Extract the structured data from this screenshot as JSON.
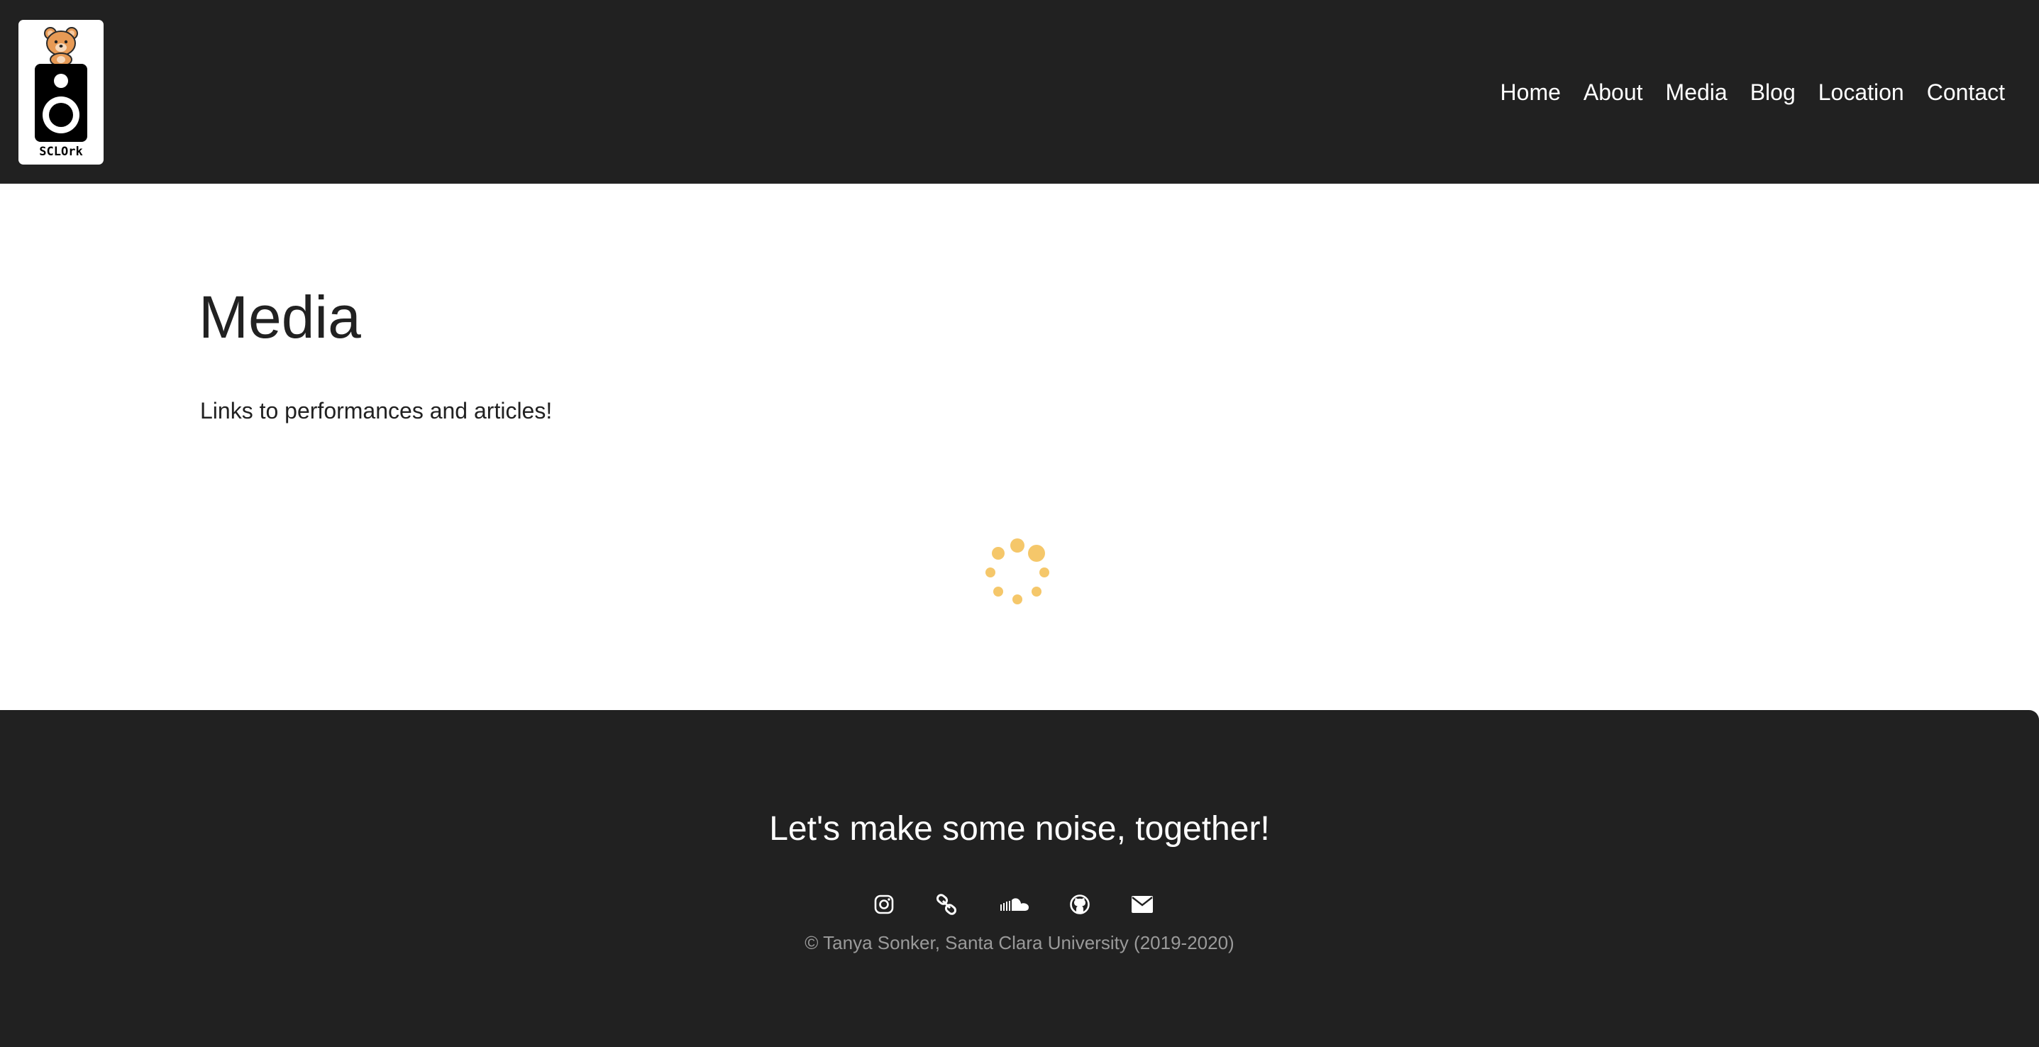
{
  "logo": {
    "text": "SCLOrk",
    "icon": "speaker-bear-logo"
  },
  "nav": {
    "items": [
      {
        "label": "Home"
      },
      {
        "label": "About"
      },
      {
        "label": "Media"
      },
      {
        "label": "Blog"
      },
      {
        "label": "Location"
      },
      {
        "label": "Contact"
      }
    ]
  },
  "main": {
    "title": "Media",
    "intro": "Links to performances and articles!",
    "loading_icon": "loading-spinner-icon"
  },
  "footer": {
    "tagline": "Let's make some noise, together!",
    "social": [
      {
        "icon": "instagram-icon"
      },
      {
        "icon": "link-icon"
      },
      {
        "icon": "soundcloud-icon"
      },
      {
        "icon": "github-icon"
      },
      {
        "icon": "envelope-icon"
      }
    ],
    "copyright": "© Tanya Sonker, Santa Clara University (2019-2020)"
  },
  "colors": {
    "header_bg": "#212121",
    "footer_bg": "#212121",
    "text": "#212121",
    "spinner": "#f5c76a",
    "copyright": "#9a9a9a"
  }
}
